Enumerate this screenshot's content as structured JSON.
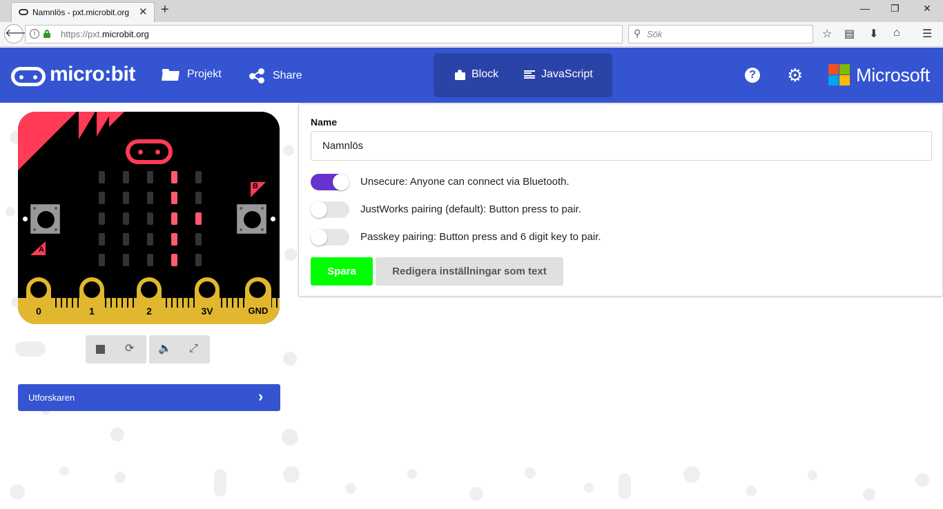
{
  "browser": {
    "tab_title": "Namnlös - pxt.microbit.org",
    "url_prefix": "https://pxt.",
    "url_domain": "microbit.org",
    "search_placeholder": "Sök"
  },
  "header": {
    "logo_text": "micro:bit",
    "projects_label": "Projekt",
    "share_label": "Share",
    "blocks_label": "Block",
    "javascript_label": "JavaScript",
    "brand_text": "Microsoft",
    "brand_colors": [
      "#f25022",
      "#7fba00",
      "#00a4ef",
      "#ffb900"
    ],
    "header_color": "#3454D1"
  },
  "simulator": {
    "button_a_label": "A",
    "button_b_label": "B",
    "pins": [
      "0",
      "1",
      "2",
      "3V",
      "GND"
    ],
    "led_on": [
      [
        0,
        0,
        0,
        1,
        0
      ],
      [
        0,
        0,
        0,
        1,
        0
      ],
      [
        0,
        0,
        0,
        1,
        1
      ],
      [
        0,
        0,
        0,
        1,
        0
      ],
      [
        0,
        0,
        0,
        1,
        0
      ]
    ],
    "explorer_label": "Utforskaren"
  },
  "settings": {
    "name_label": "Name",
    "name_value": "Namnlös",
    "options": [
      {
        "label": "Unsecure: Anyone can connect via Bluetooth.",
        "enabled": true
      },
      {
        "label": "JustWorks pairing (default): Button press to pair.",
        "enabled": false
      },
      {
        "label": "Passkey pairing: Button press and 6 digit key to pair.",
        "enabled": false
      }
    ],
    "save_label": "Spara",
    "edit_label": "Redigera inställningar som text"
  }
}
